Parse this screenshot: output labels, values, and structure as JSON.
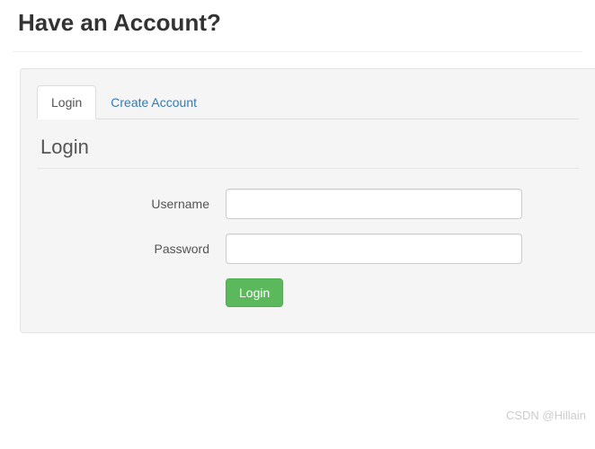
{
  "page": {
    "title": "Have an Account?"
  },
  "tabs": {
    "login": "Login",
    "create": "Create Account"
  },
  "section": {
    "title": "Login"
  },
  "form": {
    "username_label": "Username",
    "username_value": "",
    "password_label": "Password",
    "password_value": "",
    "submit_label": "Login"
  },
  "watermark": "CSDN @Hillain"
}
